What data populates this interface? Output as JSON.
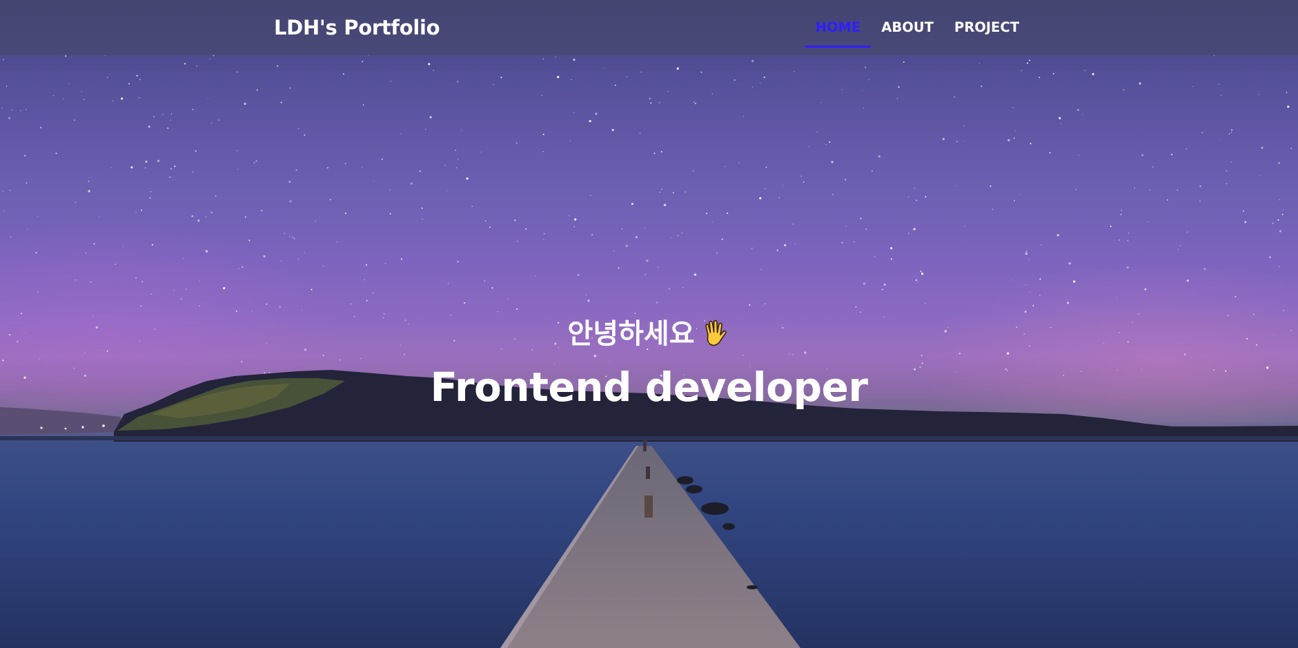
{
  "navbar": {
    "brand": "LDH's Portfolio",
    "items": [
      {
        "label": "HOME",
        "active": true
      },
      {
        "label": "ABOUT",
        "active": false
      },
      {
        "label": "PROJECT",
        "active": false
      }
    ],
    "active_color": "#2f1eff"
  },
  "hero": {
    "greeting": "안녕하세요",
    "greeting_icon": "waving-hand-icon",
    "title": "Frontend developer"
  }
}
